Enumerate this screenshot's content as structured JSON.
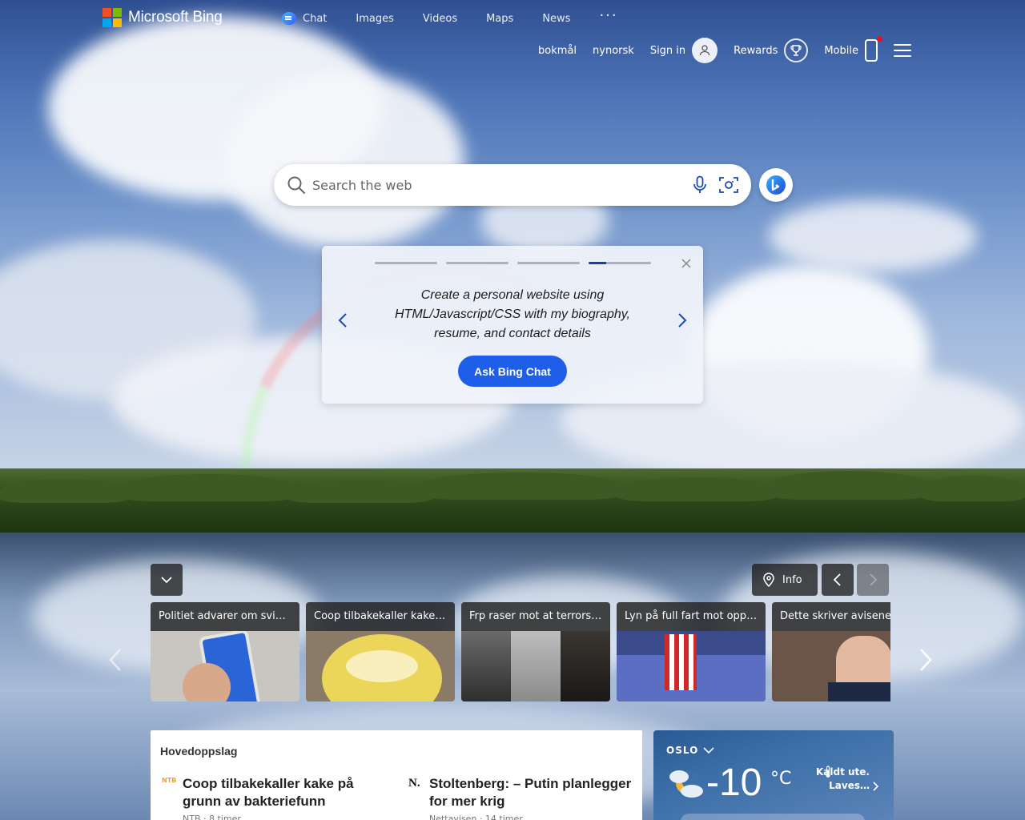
{
  "brand": {
    "name": "Microsoft Bing"
  },
  "topnav": {
    "items": [
      {
        "label": "Chat"
      },
      {
        "label": "Images"
      },
      {
        "label": "Videos"
      },
      {
        "label": "Maps"
      },
      {
        "label": "News"
      }
    ],
    "more": "···"
  },
  "subnav": {
    "lang1": "bokmål",
    "lang2": "nynorsk",
    "signin": "Sign in",
    "rewards": "Rewards",
    "mobile": "Mobile"
  },
  "search": {
    "placeholder": "Search the web",
    "value": ""
  },
  "prompt_card": {
    "text": "Create a personal website using HTML/Javascript/CSS with my biography, resume, and contact details",
    "button": "Ask Bing Chat",
    "active_step": 4,
    "steps": 4,
    "active_fill": 0.28
  },
  "carousel": {
    "info_label": "Info",
    "items": [
      {
        "title": "Politiet advarer om svindel"
      },
      {
        "title": "Coop tilbakekaller kake på grunn av bakteriefunn"
      },
      {
        "title": "Frp raser mot at terrorsiktede"
      },
      {
        "title": "Lyn på full fart mot opprykk"
      },
      {
        "title": "Dette skriver avisene"
      }
    ]
  },
  "headlines": {
    "heading": "Hovedoppslag",
    "items": [
      {
        "source_icon": "NTB",
        "title": "Coop tilbakekaller kake på grunn av bakteriefunn",
        "meta": "NTB · 8 timer"
      },
      {
        "source_icon": "N.",
        "title": "Stoltenberg: – Putin planlegger for mer krig",
        "meta": "Nettavisen · 14 timer"
      }
    ]
  },
  "weather": {
    "city": "OSLO",
    "temp": "-10",
    "unit": "°C",
    "note": "Kaldt ute. Laves…",
    "icon": "partly-cloudy-night-icon"
  },
  "colors": {
    "accent": "#1e5ee8",
    "progress_active": "#1a3ea8"
  }
}
